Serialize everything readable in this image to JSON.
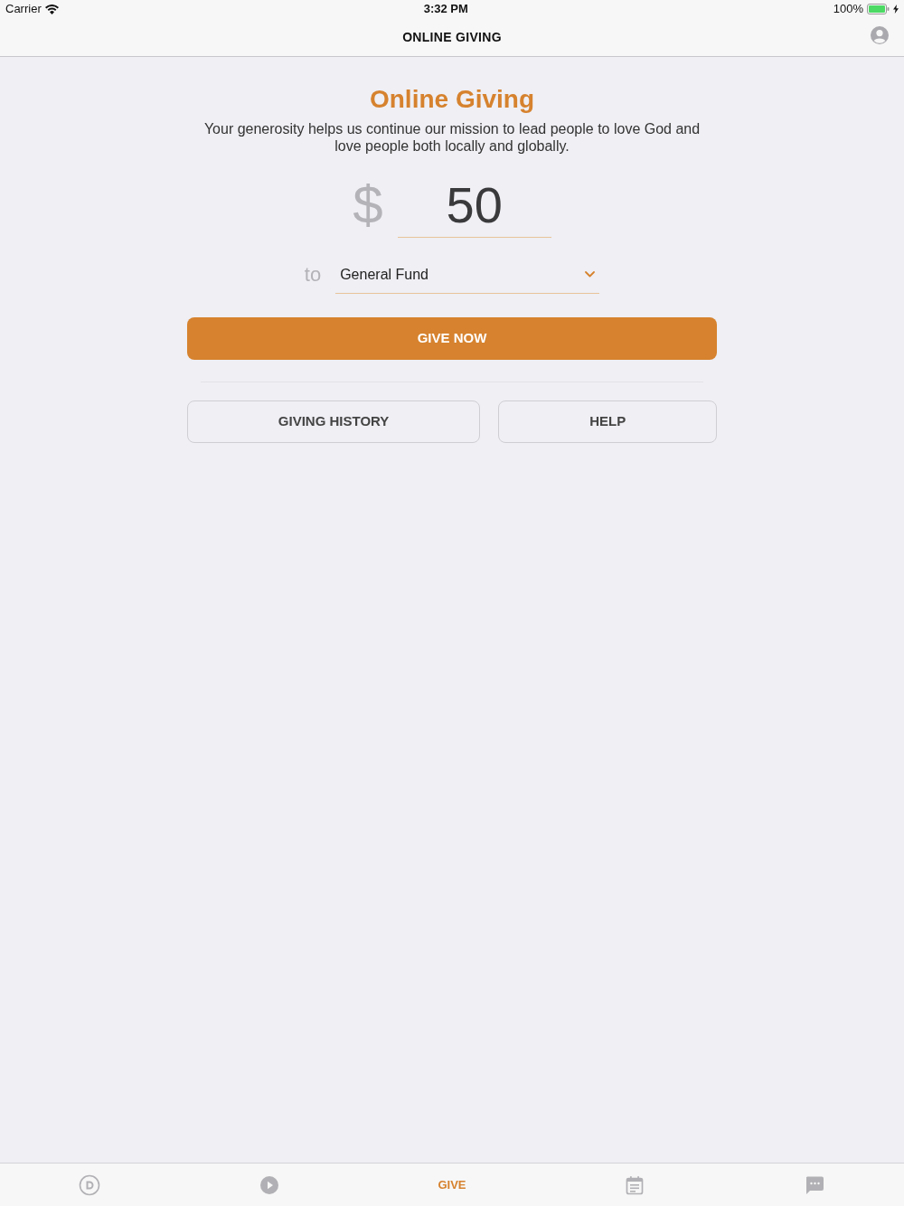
{
  "status_bar": {
    "carrier": "Carrier",
    "time": "3:32 PM",
    "battery": "100%"
  },
  "nav_bar": {
    "title": "ONLINE GIVING"
  },
  "giving": {
    "title": "Online Giving",
    "description": "Your generosity helps us continue our mission to lead people to love God and love people both locally and globally.",
    "currency_symbol": "$",
    "amount": {
      "value": "50"
    },
    "to_label": "to",
    "fund": {
      "value": "General Fund"
    },
    "give_button": "GIVE NOW",
    "buttons": [
      "GIVING HISTORY",
      "HELP"
    ]
  },
  "tab_bar": [
    {
      "kind": "logo",
      "selected": false
    },
    {
      "kind": "play",
      "selected": false
    },
    {
      "kind": "label",
      "label": "GIVE",
      "selected": true
    },
    {
      "kind": "calendar",
      "selected": false
    },
    {
      "kind": "chat",
      "selected": false
    }
  ]
}
